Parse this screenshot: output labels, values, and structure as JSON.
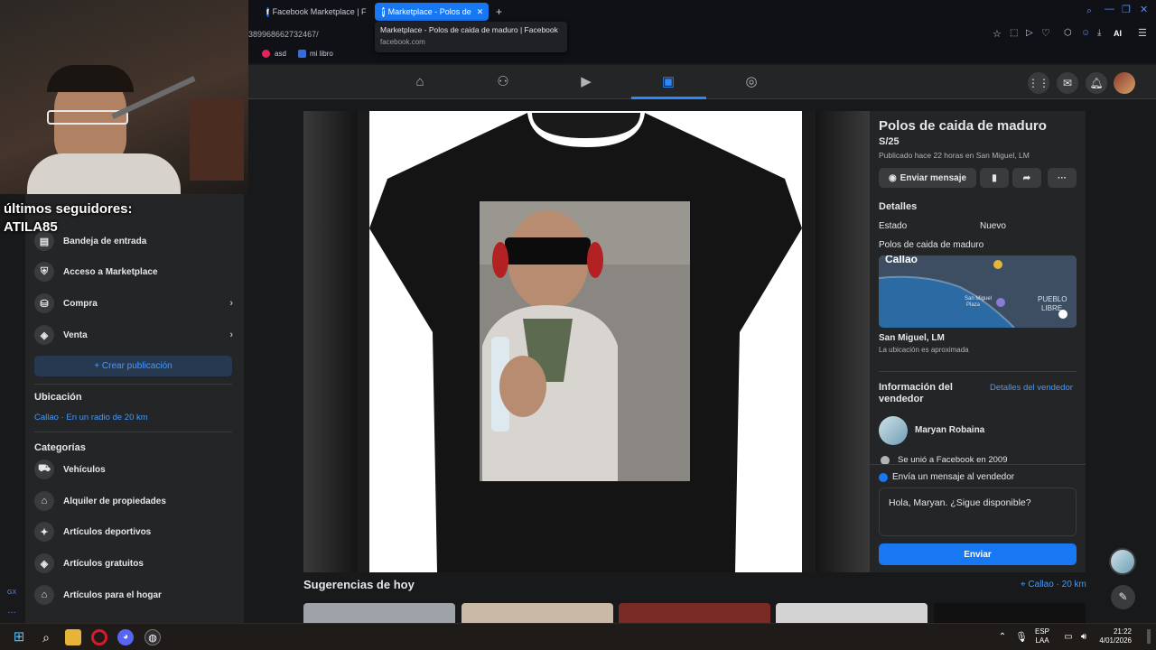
{
  "browser": {
    "tabs": [
      {
        "label": "Facebook Marketplace | F",
        "active": false
      },
      {
        "label": "Marketplace - Polos de",
        "active": true
      }
    ],
    "new_tab": "+",
    "url_fragment": "389968662732467/",
    "tooltip": {
      "title": "Marketplace - Polos de caida de maduro | Facebook",
      "domain": "facebook.com"
    },
    "bookmarks": [
      "asd",
      "mi libro"
    ],
    "ai_label": "AI"
  },
  "overlay": {
    "line1": "últimos seguidores:",
    "line2": "ATILA85"
  },
  "sidebar": {
    "items": [
      {
        "label": "Bandeja de entrada",
        "icon": "inbox-icon"
      },
      {
        "label": "Acceso a Marketplace",
        "icon": "shield-icon"
      },
      {
        "label": "Compra",
        "icon": "shopping-bag-icon"
      },
      {
        "label": "Venta",
        "icon": "tag-icon"
      }
    ],
    "create_button": "+ Crear publicación",
    "location_heading": "Ubicación",
    "location_value": "Callao · En un radio de 20 km",
    "categories_heading": "Categorías",
    "categories": [
      {
        "label": "Vehículos",
        "icon": "car-icon"
      },
      {
        "label": "Alquiler de propiedades",
        "icon": "house-key-icon"
      },
      {
        "label": "Artículos deportivos",
        "icon": "running-icon"
      },
      {
        "label": "Artículos gratuitos",
        "icon": "free-tag-icon"
      },
      {
        "label": "Artículos para el hogar",
        "icon": "home-icon"
      }
    ]
  },
  "listing": {
    "title": "Polos de caida de maduro",
    "price": "S/25",
    "published": "Publicado hace 22 horas en San Miguel, LM",
    "send_message": "Enviar mensaje",
    "details_heading": "Detalles",
    "estado_label": "Estado",
    "estado_value": "Nuevo",
    "description": "Polos de caida de maduro",
    "map_label": "Callao",
    "map_labels": [
      "PUEBLO",
      "LIBRE",
      "San Miguel",
      "Plaza"
    ],
    "location": "San Miguel, LM",
    "location_note": "La ubicación es aproximada",
    "seller_heading": "Información del vendedor",
    "seller_link": "Detalles del vendedor",
    "seller_name": "Maryan Robaina",
    "joined": "Se unió a Facebook en 2009",
    "message_heading": "Envía un mensaje al vendedor",
    "message_text": "Hola, Maryan. ¿Sigue disponible?",
    "send_button": "Enviar"
  },
  "suggestions": {
    "heading": "Sugerencias de hoy",
    "location": "Callao · 20 km"
  },
  "taskbar": {
    "lang1": "ESP",
    "lang2": "LAA",
    "time": "21:22",
    "date": "4/01/2026"
  },
  "colors": {
    "accent": "#1877f2",
    "link": "#4599ff",
    "panel": "#242526",
    "bg": "#18191a"
  }
}
